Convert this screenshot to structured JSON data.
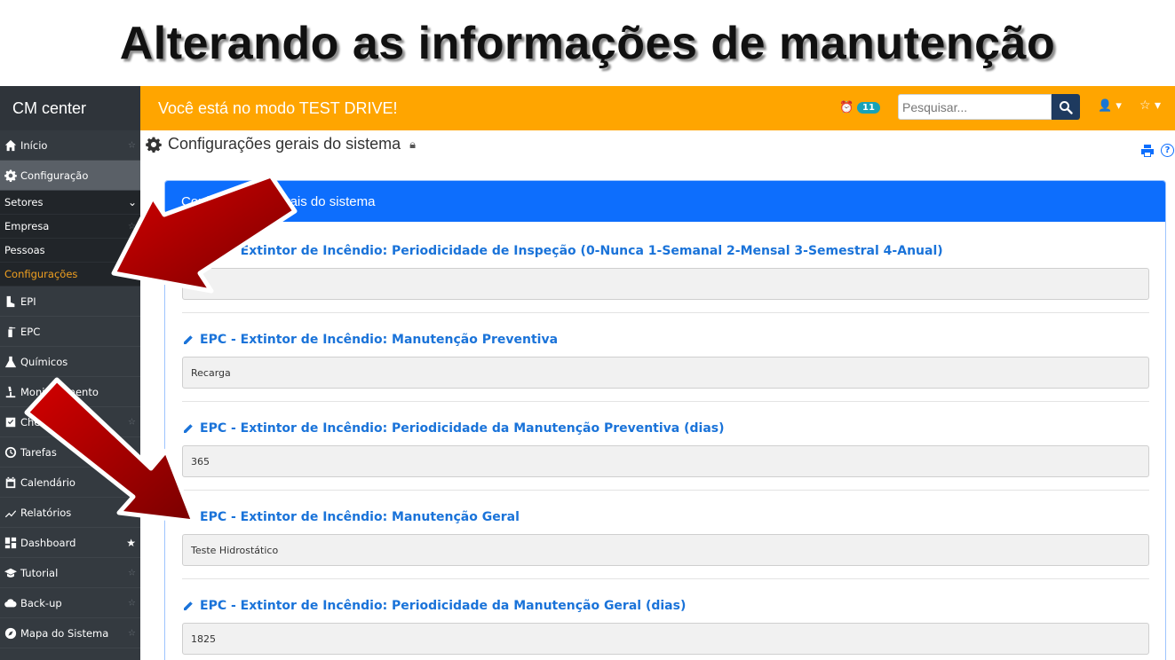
{
  "slide": {
    "title": "Alterando as informações de manutenção"
  },
  "sidebar": {
    "brand": "CM center",
    "items": [
      {
        "label": "Início",
        "icon": "home-icon"
      },
      {
        "label": "Configuração",
        "icon": "gear-icon"
      }
    ],
    "sub_items": [
      {
        "label": "Setores"
      },
      {
        "label": "Empresa"
      },
      {
        "label": "Pessoas"
      },
      {
        "label": "Configurações"
      }
    ],
    "items_after": [
      {
        "label": "EPI",
        "icon": "boot-icon"
      },
      {
        "label": "EPC",
        "icon": "extinguisher-icon"
      },
      {
        "label": "Químicos",
        "icon": "flask-icon"
      },
      {
        "label": "Monitoramento",
        "icon": "microscope-icon"
      },
      {
        "label": "Checklists",
        "icon": "checkbox-icon"
      },
      {
        "label": "Tarefas",
        "icon": "clock-icon"
      },
      {
        "label": "Calendário",
        "icon": "calendar-icon"
      },
      {
        "label": "Relatórios",
        "icon": "chart-line-icon"
      },
      {
        "label": "Dashboard",
        "icon": "dashboard-icon"
      },
      {
        "label": "Tutorial",
        "icon": "graduation-cap-icon"
      },
      {
        "label": "Back-up",
        "icon": "cloud-upload-icon"
      },
      {
        "label": "Mapa do Sistema",
        "icon": "compass-icon"
      }
    ]
  },
  "topbar": {
    "message": "Você está no modo TEST DRIVE!",
    "notification_count": "11",
    "search_placeholder": "Pesquisar..."
  },
  "page": {
    "title": "Configurações gerais do sistema"
  },
  "card": {
    "header": "Configurações gerais do sistema",
    "fields": [
      {
        "label": "EPC - Extintor de Incêndio: Periodicidade de Inspeção (0-Nunca 1-Semanal 2-Mensal 3-Semestral 4-Anual)",
        "value": "2"
      },
      {
        "label": "EPC - Extintor de Incêndio: Manutenção Preventiva",
        "value": "Recarga"
      },
      {
        "label": "EPC - Extintor de Incêndio: Periodicidade da Manutenção Preventiva (dias)",
        "value": "365"
      },
      {
        "label": "EPC - Extintor de Incêndio: Manutenção Geral",
        "value": "Teste Hidrostático"
      },
      {
        "label": "EPC - Extintor de Incêndio: Periodicidade da Manutenção Geral (dias)",
        "value": "1825"
      }
    ]
  },
  "colors": {
    "topbar": "#ffa500",
    "sidebar": "#343a40",
    "card_header": "#0d6efd",
    "arrow": "#b00000"
  }
}
